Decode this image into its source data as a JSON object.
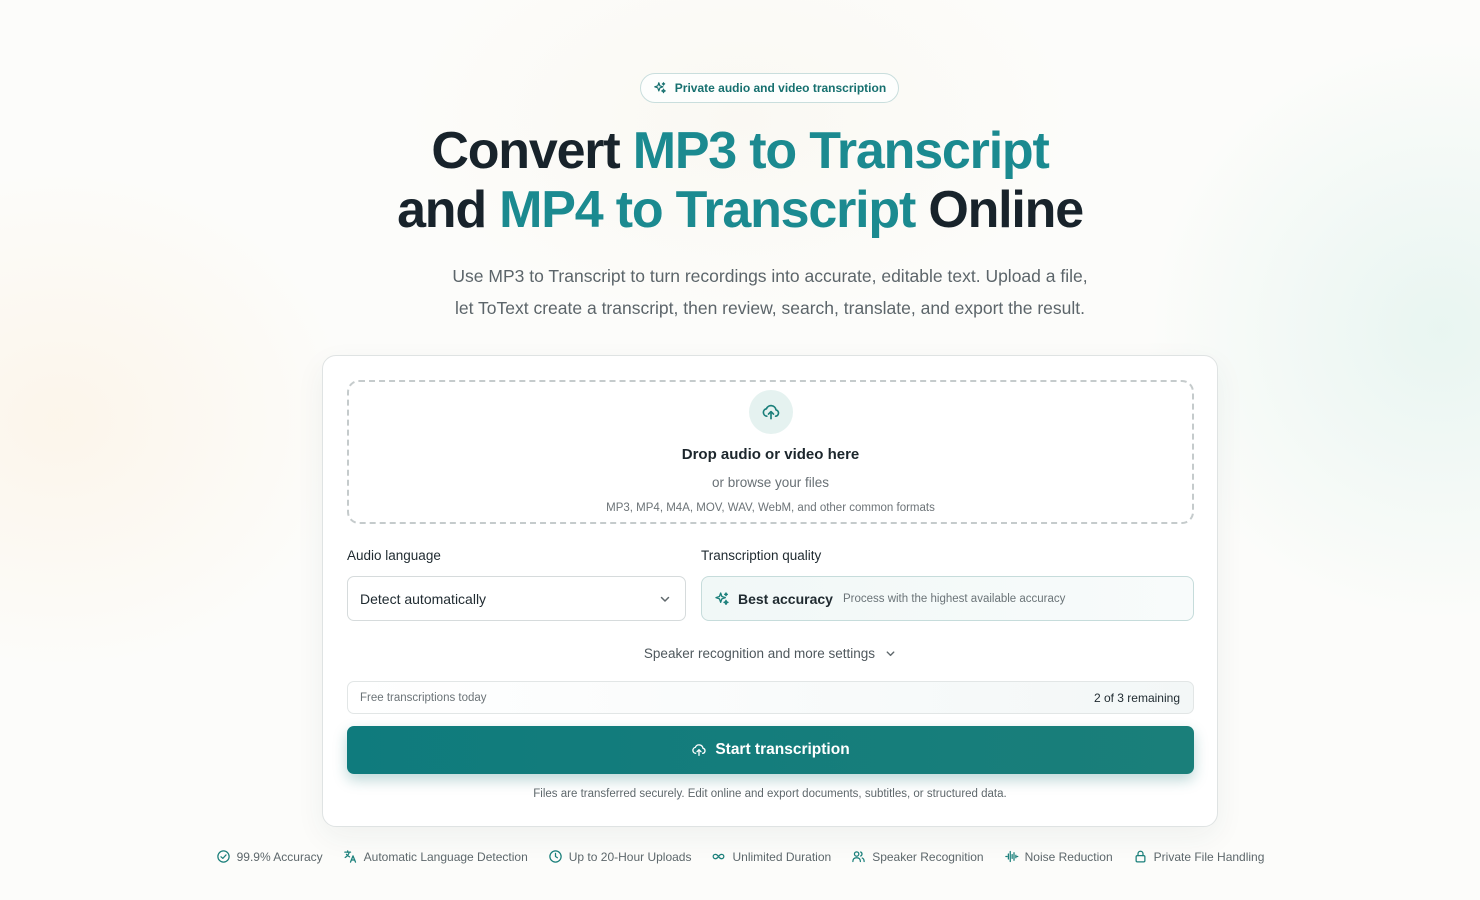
{
  "badge": {
    "icon": "sparkles-icon",
    "label": "Private audio and video transcription"
  },
  "hero": {
    "line1_prefix": "Convert ",
    "line1_accent": "MP3 to Transcript",
    "line2_prefix": "and ",
    "line2_accent": "MP4 to Transcript",
    "line2_suffix": " Online",
    "subtitle_line1": "Use MP3 to Transcript to turn recordings into accurate, editable text. Upload a file,",
    "subtitle_line2": "let ToText create a transcript, then review, search, translate, and export the result."
  },
  "dropzone": {
    "icon": "cloud-upload-icon",
    "title": "Drop audio or video here",
    "browse": "or browse your files",
    "formats": "MP3, MP4, M4A, MOV, WAV, WebM, and other common formats"
  },
  "language": {
    "label": "Audio language",
    "selected": "Detect automatically"
  },
  "quality": {
    "label": "Transcription quality",
    "title": "Best accuracy",
    "description": "Process with the highest available accuracy"
  },
  "more_settings": "Speaker recognition and more settings",
  "quota": {
    "label": "Free transcriptions today",
    "value": "2 of 3 remaining"
  },
  "start_button": "Start transcription",
  "secure_note": "Files are transferred securely. Edit online and export documents, subtitles, or structured data.",
  "features": [
    {
      "icon": "check-circle-icon",
      "label": "99.9% Accuracy"
    },
    {
      "icon": "translate-icon",
      "label": "Automatic Language Detection"
    },
    {
      "icon": "clock-icon",
      "label": "Up to 20-Hour Uploads"
    },
    {
      "icon": "infinity-icon",
      "label": "Unlimited Duration"
    },
    {
      "icon": "users-icon",
      "label": "Speaker Recognition"
    },
    {
      "icon": "audio-wave-icon",
      "label": "Noise Reduction"
    },
    {
      "icon": "lock-icon",
      "label": "Private File Handling"
    }
  ],
  "colors": {
    "accent": "#1b8a90",
    "button": "#0f7b7d",
    "heading": "#18232b"
  }
}
